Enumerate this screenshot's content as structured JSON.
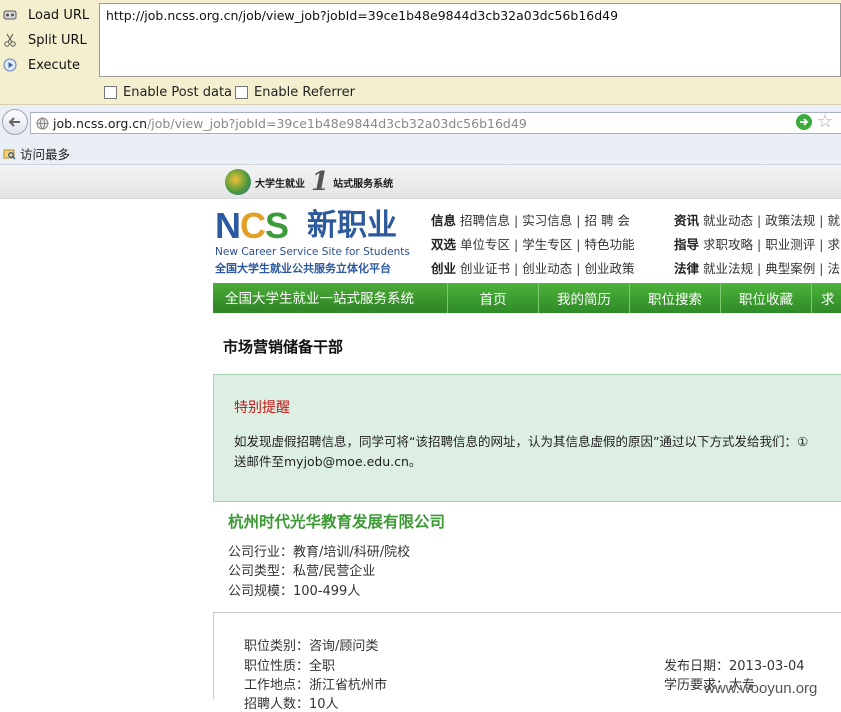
{
  "hackbar": {
    "load_label": "Load URL",
    "split_label": "Split URL",
    "execute_label": "Execute",
    "url_value": "http://job.ncss.org.cn/job/view_job?jobId=39ce1b48e9844d3cb32a03dc56b16d49",
    "enable_post_label": "Enable Post data",
    "enable_referrer_label": "Enable Referrer"
  },
  "address_bar": {
    "host": "job.ncss.org.cn",
    "path": "/job/view_job?jobId=39ce1b48e9844d3cb32a03dc56b16d49"
  },
  "bookmarks": {
    "most_visited": "访问最多"
  },
  "site": {
    "strip_logo_left": "大学生就业",
    "strip_logo_right": "站式服务系统",
    "logo_ncs": [
      "N",
      "C",
      "S"
    ],
    "logo_name": "新职业",
    "logo_en": "New Career Service Site for Students",
    "logo_cn": "全国大学生就业公共服务立体化平台",
    "nav_rows": [
      {
        "head": "信息",
        "items": [
          "招聘信息",
          "实习信息",
          "招 聘 会"
        ]
      },
      {
        "head": "双选",
        "items": [
          "单位专区",
          "学生专区",
          "特色功能"
        ]
      },
      {
        "head": "创业",
        "items": [
          "创业证书",
          "创业动态",
          "创业政策"
        ]
      }
    ],
    "nav_rows_right": [
      {
        "head": "资讯",
        "items": [
          "就业动态",
          "政策法规",
          "就"
        ]
      },
      {
        "head": "指导",
        "items": [
          "求职攻略",
          "职业测评",
          "求"
        ]
      },
      {
        "head": "法律",
        "items": [
          "就业法规",
          "典型案例",
          "法"
        ]
      }
    ],
    "green_title": "全国大学生就业一站式服务系统",
    "tabs": [
      "首页",
      "我的简历",
      "职位搜索",
      "职位收藏",
      "求"
    ]
  },
  "job": {
    "title": "市场营销储备干部",
    "notice_title": "特别提醒",
    "notice_line1": "如发现虚假招聘信息，同学可将“该招聘信息的网址，认为其信息虚假的原因”通过以下方式发给我们：①",
    "notice_line2": "送邮件至myjob@moe.edu.cn。",
    "company_name": "杭州时代光华教育发展有限公司",
    "company_industry": "公司行业：教育/培训/科研/院校",
    "company_type": "公司类型：私营/民营企业",
    "company_size": "公司规模：100-499人",
    "category": "职位类别：咨询/顾问类",
    "nature": "职位性质：全职",
    "location": "工作地点：浙江省杭州市",
    "headcount": "招聘人数：10人",
    "publish_date": "发布日期：2013-03-04",
    "education": "学历要求：大专"
  },
  "watermark": "www.wooyun.org",
  "colors": {
    "hackbar_bg": "#f4efcf",
    "site_green": "#3c9a35",
    "notice_bg": "#dcefe2",
    "notice_red": "#c61a1a"
  }
}
